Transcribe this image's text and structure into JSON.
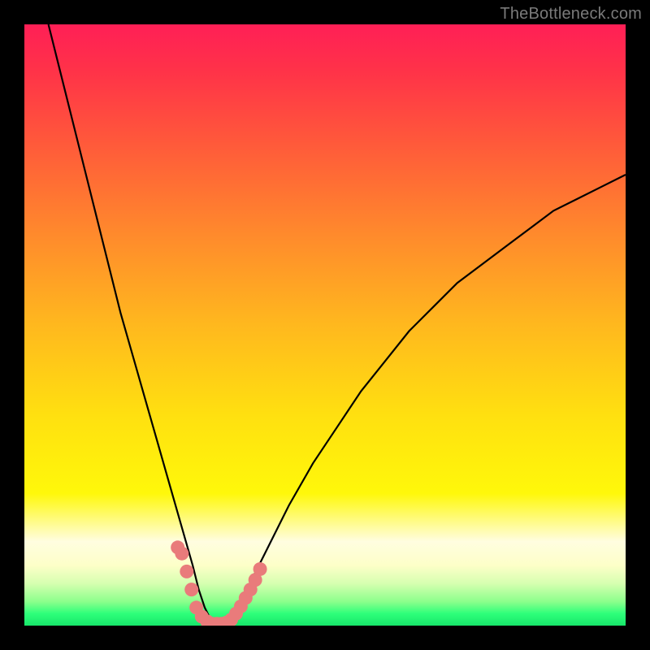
{
  "watermark": "TheBottleneck.com",
  "accent_colors": {
    "top": "#ff1f56",
    "mid": "#ffe010",
    "bottom": "#17e66a",
    "curve": "#000000",
    "marker": "#e97b7b",
    "frame": "#000000"
  },
  "chart_data": {
    "type": "line",
    "title": "",
    "xlabel": "",
    "ylabel": "",
    "xlim": [
      0,
      100
    ],
    "ylim": [
      0,
      100
    ],
    "grid": false,
    "legend": false,
    "series": [
      {
        "name": "bottleneck-curve",
        "x": [
          4,
          6,
          8,
          10,
          12,
          14,
          16,
          18,
          20,
          22,
          24,
          26,
          28,
          29,
          30,
          31,
          32,
          33,
          34,
          36,
          38,
          40,
          44,
          48,
          52,
          56,
          60,
          64,
          68,
          72,
          76,
          80,
          84,
          88,
          92,
          96,
          100
        ],
        "y": [
          100,
          92,
          84,
          76,
          68,
          60,
          52,
          45,
          38,
          31,
          24,
          17,
          10,
          6,
          3,
          1,
          0,
          0,
          1,
          4,
          8,
          12,
          20,
          27,
          33,
          39,
          44,
          49,
          53,
          57,
          60,
          63,
          66,
          69,
          71,
          73,
          75
        ]
      }
    ],
    "markers": {
      "name": "sample-points",
      "x": [
        25.5,
        26.2,
        27.0,
        27.8,
        28.6,
        29.5,
        30.4,
        31.2,
        32.0,
        32.8,
        33.6,
        34.4,
        35.2,
        36.0,
        36.8,
        37.6,
        38.4,
        39.2
      ],
      "y": [
        13,
        12,
        9,
        6,
        3,
        1.5,
        0.7,
        0.3,
        0.3,
        0.3,
        0.5,
        1.0,
        2.0,
        3.2,
        4.6,
        6.0,
        7.6,
        9.4
      ]
    },
    "annotations": []
  }
}
